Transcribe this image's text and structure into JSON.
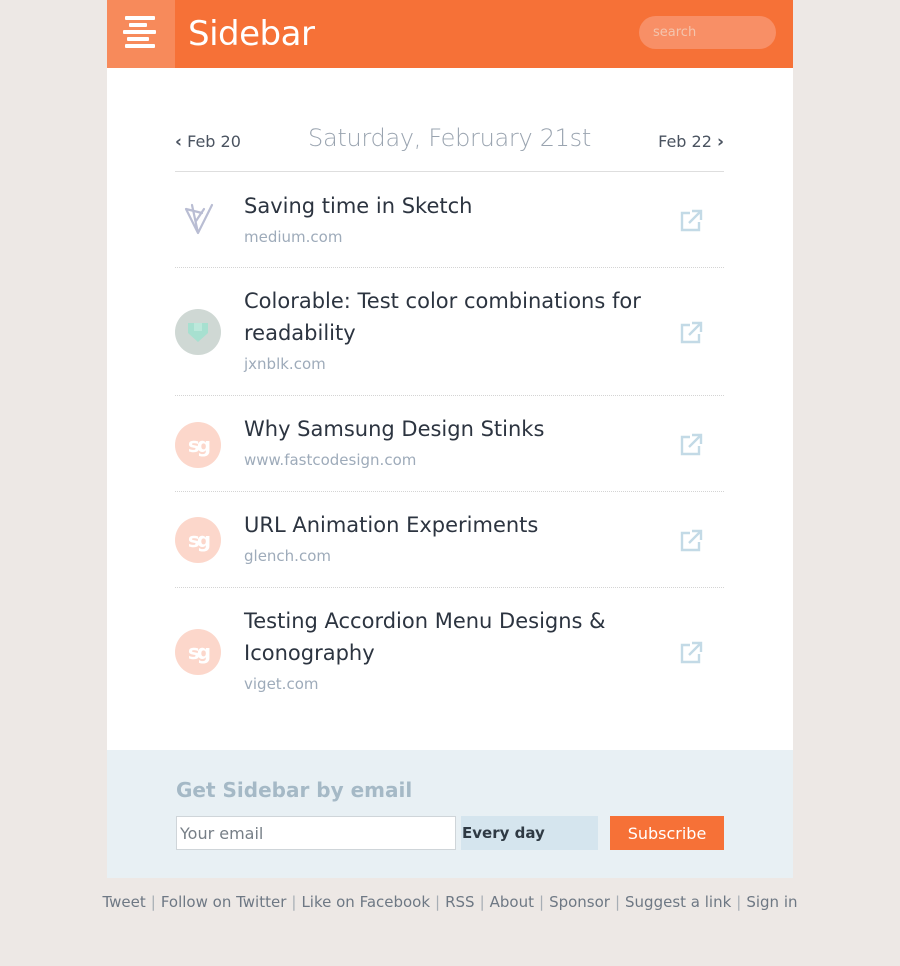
{
  "brand": {
    "title": "Sidebar",
    "accent_color": "#f67137",
    "logo_icon": "menu-stripes-icon"
  },
  "search": {
    "placeholder": "search",
    "icon": "none"
  },
  "date_nav": {
    "prev_label": "Feb 20",
    "next_label": "Feb 22",
    "current_date": "Saturday, February 21st",
    "prev_icon": "chevron-left-icon",
    "next_icon": "chevron-right-icon"
  },
  "links": [
    {
      "title": "Saving time in Sketch",
      "domain": "medium.com",
      "avatar": "sketch-icon"
    },
    {
      "title": "Colorable: Test color combinations for readability",
      "domain": "jxnblk.com",
      "avatar": "colorable-icon"
    },
    {
      "title": "Why Samsung Design Stinks",
      "domain": "www.fastcodesign.com",
      "avatar": "sg-icon"
    },
    {
      "title": "URL Animation Experiments",
      "domain": "glench.com",
      "avatar": "sg-icon"
    },
    {
      "title": "Testing Accordion Menu Designs & Iconography",
      "domain": "viget.com",
      "avatar": "sg-icon"
    }
  ],
  "avatar_glyph": "sg",
  "signup": {
    "title": "Get Sidebar by email",
    "email_placeholder": "Your email",
    "frequency": "Every day",
    "subscribe_label": "Subscribe"
  },
  "footer": {
    "links": [
      "Tweet",
      "Follow on Twitter",
      "Like on Facebook",
      "RSS",
      "About",
      "Sponsor",
      "Suggest a link",
      "Sign in"
    ]
  }
}
